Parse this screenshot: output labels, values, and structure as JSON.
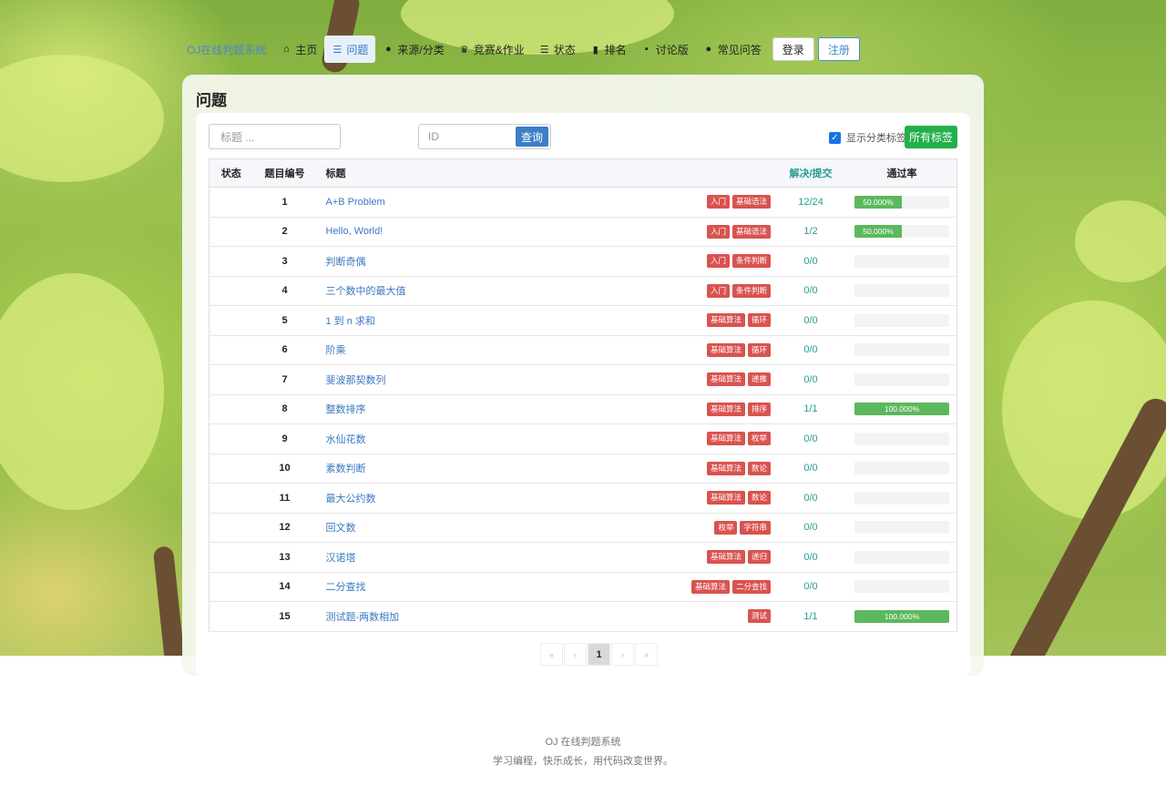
{
  "nav": {
    "brand": "OJ在线判题系统",
    "items": [
      {
        "label": "主页",
        "icon": "home-icon",
        "glyph": "⌂",
        "active": false
      },
      {
        "label": "问题",
        "icon": "list-icon",
        "glyph": "☰",
        "active": true
      },
      {
        "label": "来源/分类",
        "icon": "dot-icon",
        "glyph": "●",
        "active": false
      },
      {
        "label": "竞赛&作业",
        "icon": "trophy-icon",
        "glyph": "♛",
        "active": false
      },
      {
        "label": "状态",
        "icon": "list-icon",
        "glyph": "☰",
        "active": false
      },
      {
        "label": "排名",
        "icon": "bar-chart-icon",
        "glyph": "▮",
        "active": false
      },
      {
        "label": "讨论版",
        "icon": "comment-icon",
        "glyph": "▪",
        "active": false
      },
      {
        "label": "常见问答",
        "icon": "dot-icon",
        "glyph": "●",
        "active": false
      }
    ],
    "login": "登录",
    "register": "注册"
  },
  "page": {
    "title": "问题",
    "title_placeholder": "标题 ...",
    "id_placeholder": "ID",
    "query_button": "查询",
    "show_category_label": "显示分类标签",
    "show_category_checked": true,
    "all_tags_button": "所有标签"
  },
  "table": {
    "headers": {
      "status": "状态",
      "num": "题目编号",
      "title": "标题",
      "solved": "解决/提交",
      "rate": "通过率"
    },
    "rows": [
      {
        "num": "1",
        "title": "A+B Problem",
        "tags": [
          "入门",
          "基础语法"
        ],
        "solved": "12/24",
        "rate": "50.000%",
        "pct": 50
      },
      {
        "num": "2",
        "title": "Hello, World!",
        "tags": [
          "入门",
          "基础语法"
        ],
        "solved": "1/2",
        "rate": "50.000%",
        "pct": 50
      },
      {
        "num": "3",
        "title": "判断奇偶",
        "tags": [
          "入门",
          "条件判断"
        ],
        "solved": "0/0",
        "rate": "",
        "pct": 0
      },
      {
        "num": "4",
        "title": "三个数中的最大值",
        "tags": [
          "入门",
          "条件判断"
        ],
        "solved": "0/0",
        "rate": "",
        "pct": 0
      },
      {
        "num": "5",
        "title": "1 到 n 求和",
        "tags": [
          "基础算法",
          "循环"
        ],
        "solved": "0/0",
        "rate": "",
        "pct": 0
      },
      {
        "num": "6",
        "title": "阶乘",
        "tags": [
          "基础算法",
          "循环"
        ],
        "solved": "0/0",
        "rate": "",
        "pct": 0
      },
      {
        "num": "7",
        "title": "斐波那契数列",
        "tags": [
          "基础算法",
          "递推"
        ],
        "solved": "0/0",
        "rate": "",
        "pct": 0
      },
      {
        "num": "8",
        "title": "整数排序",
        "tags": [
          "基础算法",
          "排序"
        ],
        "solved": "1/1",
        "rate": "100.000%",
        "pct": 100
      },
      {
        "num": "9",
        "title": "水仙花数",
        "tags": [
          "基础算法",
          "枚举"
        ],
        "solved": "0/0",
        "rate": "",
        "pct": 0
      },
      {
        "num": "10",
        "title": "素数判断",
        "tags": [
          "基础算法",
          "数论"
        ],
        "solved": "0/0",
        "rate": "",
        "pct": 0
      },
      {
        "num": "11",
        "title": "最大公约数",
        "tags": [
          "基础算法",
          "数论"
        ],
        "solved": "0/0",
        "rate": "",
        "pct": 0
      },
      {
        "num": "12",
        "title": "回文数",
        "tags": [
          "枚举",
          "字符串"
        ],
        "solved": "0/0",
        "rate": "",
        "pct": 0
      },
      {
        "num": "13",
        "title": "汉诺塔",
        "tags": [
          "基础算法",
          "递归"
        ],
        "solved": "0/0",
        "rate": "",
        "pct": 0
      },
      {
        "num": "14",
        "title": "二分查找",
        "tags": [
          "基础算法",
          "二分查找"
        ],
        "solved": "0/0",
        "rate": "",
        "pct": 0
      },
      {
        "num": "15",
        "title": "测试题-两数相加",
        "tags": [
          "测试"
        ],
        "solved": "1/1",
        "rate": "100.000%",
        "pct": 100
      }
    ]
  },
  "pager": {
    "first": "«",
    "prev": "‹",
    "current": "1",
    "next": "›",
    "last": "»"
  },
  "footer": {
    "line1": "OJ 在线判题系统",
    "line2": "学习编程，快乐成长，用代码改变世界。"
  },
  "colors": {
    "accent": "#3d7fc6",
    "tag": "#d9534f",
    "success": "#22b04b",
    "progress": "#5cb85c"
  }
}
